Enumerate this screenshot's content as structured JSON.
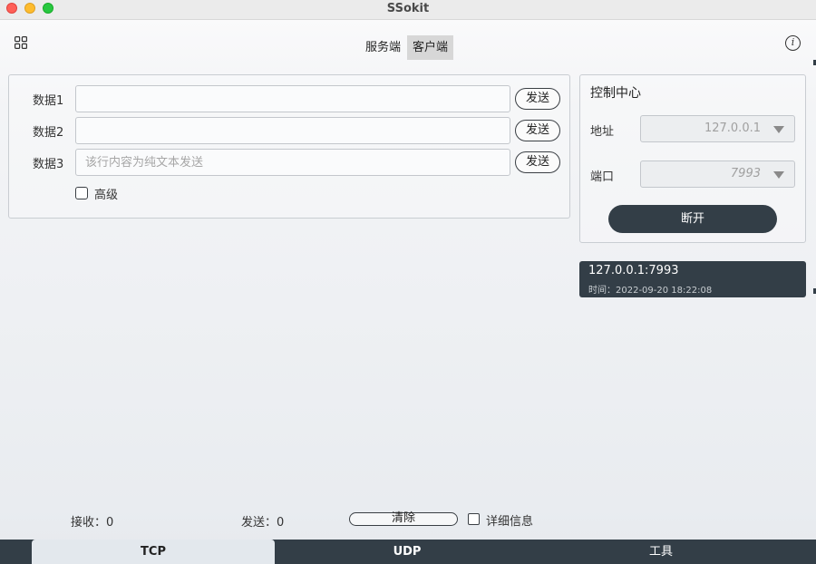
{
  "window": {
    "title": "SSokit"
  },
  "mode_tabs": [
    {
      "label": "服务端",
      "selected": false
    },
    {
      "label": "客户端",
      "selected": true
    }
  ],
  "data_rows": [
    {
      "label": "数据1",
      "value": "",
      "placeholder": "",
      "send_label": "发送"
    },
    {
      "label": "数据2",
      "value": "",
      "placeholder": "",
      "send_label": "发送"
    },
    {
      "label": "数据3",
      "value": "",
      "placeholder": "该行内容为纯文本发送",
      "send_label": "发送"
    }
  ],
  "advanced": {
    "label": "高级",
    "checked": false
  },
  "control_center": {
    "title": "控制中心",
    "address_label": "地址",
    "address_value": "127.0.0.1",
    "port_label": "端口",
    "port_value": "7993",
    "disconnect_label": "断开"
  },
  "connection": {
    "address": "127.0.0.1:7993",
    "time": "时间：2022-09-20 18:22:08"
  },
  "status": {
    "received": "接收：0",
    "sent": "发送：0",
    "clear_label": "清除",
    "detail_label": "详细信息",
    "detail_checked": false
  },
  "bottom_tabs": [
    {
      "label": "TCP",
      "selected": true
    },
    {
      "label": "UDP",
      "selected": false
    },
    {
      "label": "工具",
      "selected": false
    }
  ],
  "colors": {
    "dark_accent": "#333e47",
    "selected_tab": "#e3e8ed"
  }
}
